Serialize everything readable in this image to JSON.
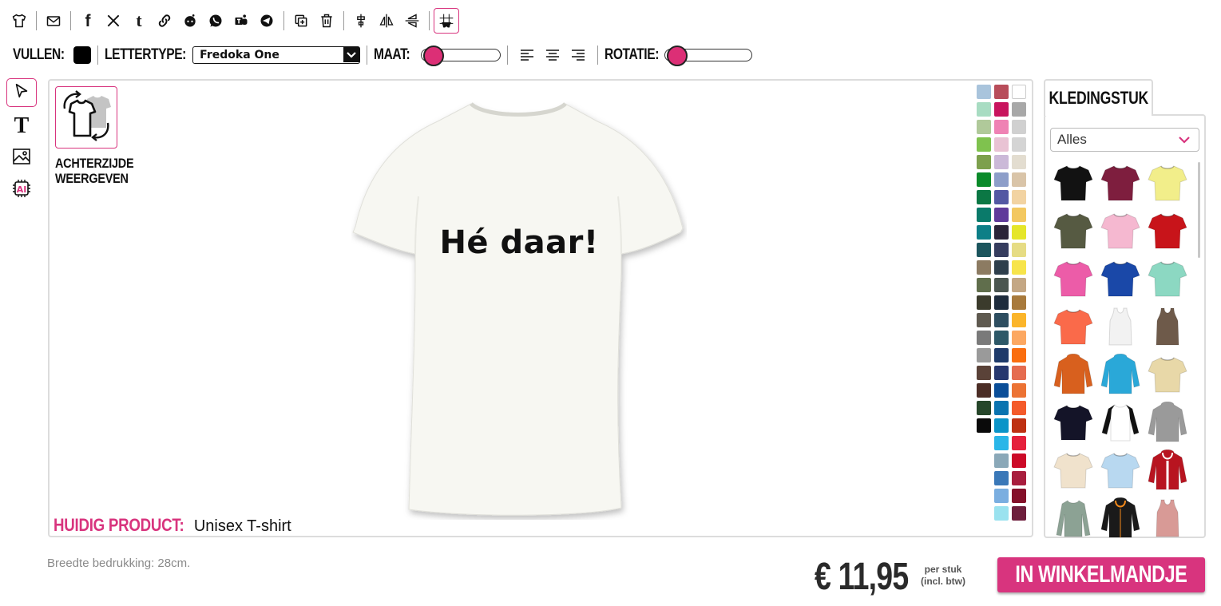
{
  "toolbar2": {
    "fill_label": "VULLEN:",
    "fill_color": "#000000",
    "font_label": "LETTERTYPE:",
    "font_value": "Fredoka One",
    "size_label": "MAAT:",
    "size_level": 0.05,
    "rotation_label": "ROTATIE:",
    "rotation_level": 0.05
  },
  "canvas": {
    "back_label_1": "ACHTERZIJDE",
    "back_label_2": "WEERGEVEN",
    "design_text": "Hé daar!",
    "current_product_label": "HUIDIG PRODUCT:",
    "current_product_value": "Unisex T-shirt",
    "palette_colors": [
      "#a9c4dc",
      "#b84d5a",
      "#ffffff",
      "#a8dcc2",
      "#c8155e",
      "#a8a8a8",
      "#b0c99a",
      "#ef82b4",
      "#d0d0d0",
      "#7fc24e",
      "#e9c3d4",
      "#d4d4d4",
      "#7da04d",
      "#cbb9d8",
      "#e3ddd0",
      "#0a8a2a",
      "#8d9ec9",
      "#d9c4a8",
      "#0b7744",
      "#5358a3",
      "#f2d3a2",
      "#0a7a6a",
      "#5f3a9a",
      "#f3c860",
      "#0d7f87",
      "#2b2438",
      "#e5e62a",
      "#1c555d",
      "#363d5e",
      "#e6dc84",
      "#8c7b62",
      "#2e3f4c",
      "#f7e44a",
      "#606e4c",
      "#4b5650",
      "#c4a784",
      "#3b3b2c",
      "#1e2c3c",
      "#a87a3c",
      "#5f5a50",
      "#2e4e60",
      "#fbb52a",
      "#7a7a7a",
      "#2d5868",
      "#fca862",
      "#9a9a9a",
      "#1e3a6a",
      "#fa6e10",
      "#5a4238",
      "#26376e",
      "#e56c50",
      "#4c2e26",
      "#0b4e98",
      "#ec7334",
      "#26462a",
      "#0a74b0",
      "#f45a2a",
      "#0a0a0a",
      "#0a94c8",
      "#be3012",
      null,
      "#2ab6e8",
      "#e5203c",
      null,
      "#8aa8b8",
      "#cc0a28",
      null,
      "#3a78b8",
      "#a81e3e",
      null,
      "#7aaee0",
      "#84102a",
      null,
      "#9ae2ef",
      "#6e1e3c"
    ]
  },
  "right_panel": {
    "tab_label": "KLEDINGSTUK",
    "filter_value": "Alles",
    "garments": [
      {
        "name": "tshirt-black",
        "color": "#121212",
        "type": "tee"
      },
      {
        "name": "tshirt-maroon",
        "color": "#7e1e3e",
        "type": "tee"
      },
      {
        "name": "tshirt-yellow",
        "color": "#f2ee8a",
        "type": "tee"
      },
      {
        "name": "tshirt-olive",
        "color": "#565a42",
        "type": "tee"
      },
      {
        "name": "tshirt-light-pink",
        "color": "#f5b8d0",
        "type": "tee"
      },
      {
        "name": "tshirt-red",
        "color": "#c8141a",
        "type": "tee"
      },
      {
        "name": "tshirt-pink",
        "color": "#ec5ca8",
        "type": "tee"
      },
      {
        "name": "tshirt-royal-blue",
        "color": "#1a48a8",
        "type": "tee"
      },
      {
        "name": "tshirt-mint",
        "color": "#8cd8c2",
        "type": "tee"
      },
      {
        "name": "tshirt-coral",
        "color": "#fa6a4a",
        "type": "tee"
      },
      {
        "name": "tanktop-white",
        "color": "#f2f2f2",
        "type": "tank"
      },
      {
        "name": "tanktop-brown",
        "color": "#6e5a4a",
        "type": "tank"
      },
      {
        "name": "hoodie-orange",
        "color": "#d8601e",
        "type": "hoodie"
      },
      {
        "name": "hoodie-turquoise",
        "color": "#2aa8d8",
        "type": "hoodie"
      },
      {
        "name": "tshirt-tiedye",
        "color": "#e8d8a8",
        "type": "tee"
      },
      {
        "name": "tshirt-navy",
        "color": "#141428",
        "type": "tee"
      },
      {
        "name": "raglan-black-white",
        "color": "#ffffff",
        "type": "raglan"
      },
      {
        "name": "hoodie-grey",
        "color": "#9a9a9a",
        "type": "hoodie"
      },
      {
        "name": "tshirt-sand",
        "color": "#f0e2cc",
        "type": "tee"
      },
      {
        "name": "tshirt-light-blue",
        "color": "#b8d8f0",
        "type": "tee"
      },
      {
        "name": "jacket-red-white",
        "color": "#b81420",
        "type": "jacket"
      },
      {
        "name": "longsleeve-sage",
        "color": "#8ca294",
        "type": "longsleeve"
      },
      {
        "name": "hoodie-black-orange",
        "color": "#1a1a1a",
        "type": "hoodie"
      },
      {
        "name": "tanktop-rose",
        "color": "#d89a96",
        "type": "tank"
      }
    ]
  },
  "bottom": {
    "print_width": "Breedte bedrukking: 28cm.",
    "price": "€ 11,95",
    "per_piece_1": "per stuk",
    "per_piece_2": "(incl. btw)",
    "cart_label": "IN WINKELMANDJE"
  }
}
